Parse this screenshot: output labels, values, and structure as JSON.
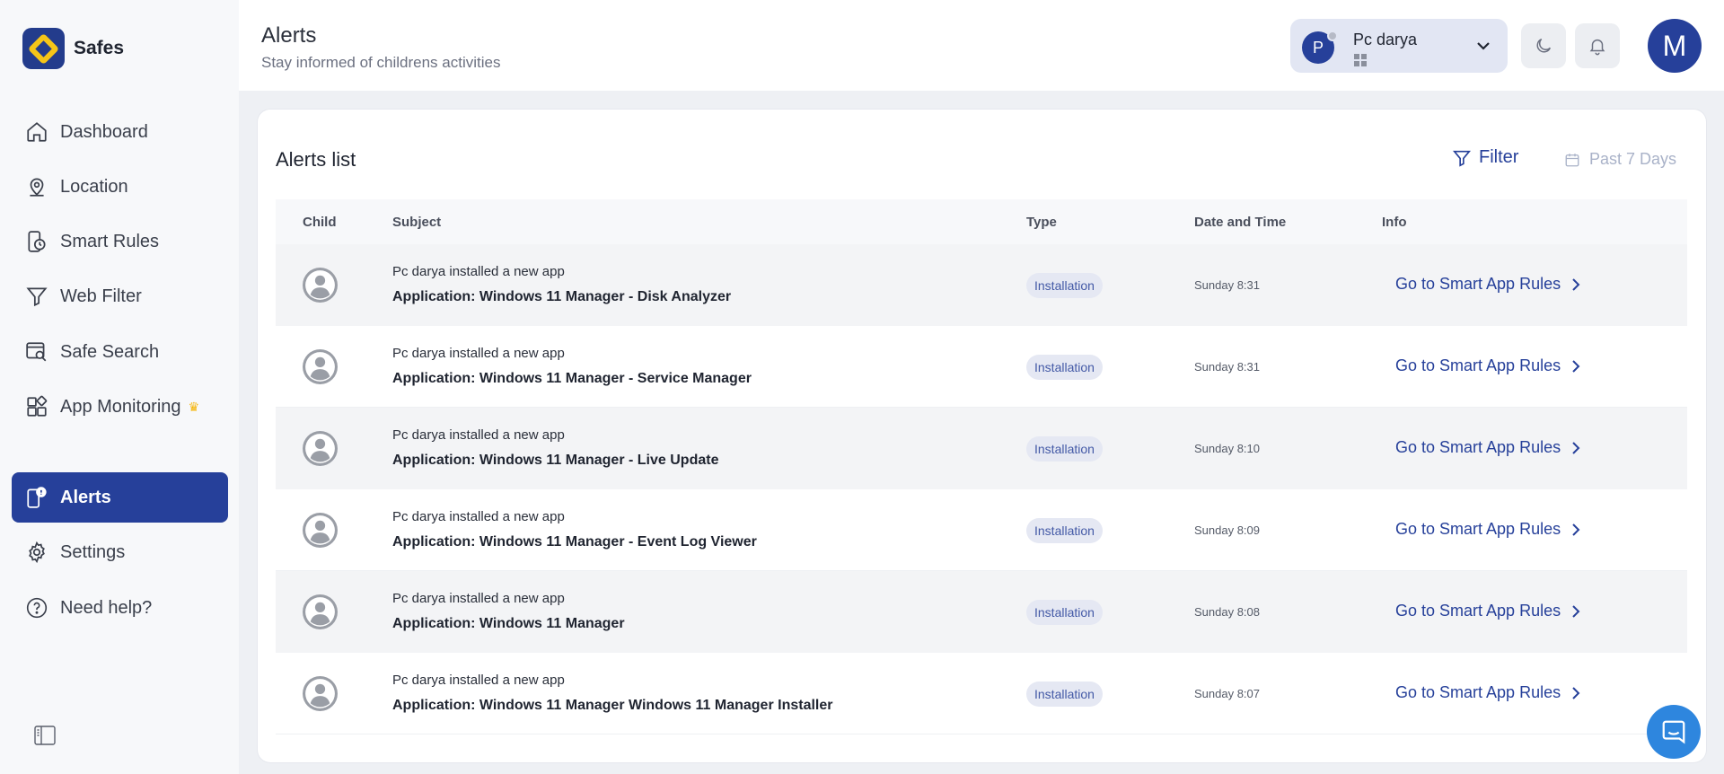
{
  "brand": {
    "name": "Safes"
  },
  "sidebar": {
    "items": [
      {
        "label": "Dashboard",
        "icon": "home-icon"
      },
      {
        "label": "Location",
        "icon": "location-pin-icon"
      },
      {
        "label": "Smart Rules",
        "icon": "phone-clock-icon"
      },
      {
        "label": "Web Filter",
        "icon": "funnel-icon"
      },
      {
        "label": "Safe Search",
        "icon": "search-window-icon"
      },
      {
        "label": "App Monitoring",
        "icon": "apps-grid-icon"
      },
      {
        "label": "Alerts",
        "icon": "alert-phone-icon",
        "active": true
      },
      {
        "label": "Settings",
        "icon": "gear-icon"
      },
      {
        "label": "Need help?",
        "icon": "help-circle-icon"
      }
    ]
  },
  "header": {
    "title": "Alerts",
    "subtitle": "Stay informed of childrens activities",
    "device": {
      "initial": "P",
      "name": "Pc darya",
      "os_icon": "windows-icon"
    },
    "profile_initial": "M"
  },
  "card": {
    "title": "Alerts list",
    "filter_label": "Filter",
    "range_label": "Past 7 Days"
  },
  "table": {
    "columns": [
      "Child",
      "Subject",
      "Type",
      "Date and Time",
      "Info"
    ],
    "rows": [
      {
        "line1": "Pc darya installed a new app",
        "line2": "Application: Windows 11 Manager - Disk Analyzer",
        "type": "Installation",
        "datetime": "Sunday 8:31",
        "link": "Go to Smart App Rules"
      },
      {
        "line1": "Pc darya installed a new app",
        "line2": "Application: Windows 11 Manager - Service Manager",
        "type": "Installation",
        "datetime": "Sunday 8:31",
        "link": "Go to Smart App Rules"
      },
      {
        "line1": "Pc darya installed a new app",
        "line2": "Application: Windows 11 Manager - Live Update",
        "type": "Installation",
        "datetime": "Sunday 8:10",
        "link": "Go to Smart App Rules"
      },
      {
        "line1": "Pc darya installed a new app",
        "line2": "Application: Windows 11 Manager - Event Log Viewer",
        "type": "Installation",
        "datetime": "Sunday 8:09",
        "link": "Go to Smart App Rules"
      },
      {
        "line1": "Pc darya installed a new app",
        "line2": "Application: Windows 11 Manager",
        "type": "Installation",
        "datetime": "Sunday 8:08",
        "link": "Go to Smart App Rules"
      },
      {
        "line1": "Pc darya installed a new app",
        "line2": "Application: Windows 11 Manager Windows 11 Manager Installer",
        "type": "Installation",
        "datetime": "Sunday 8:07",
        "link": "Go to Smart App Rules"
      }
    ]
  },
  "colors": {
    "primary": "#26409a",
    "accent": "#f5c518",
    "chat": "#2e86de"
  }
}
